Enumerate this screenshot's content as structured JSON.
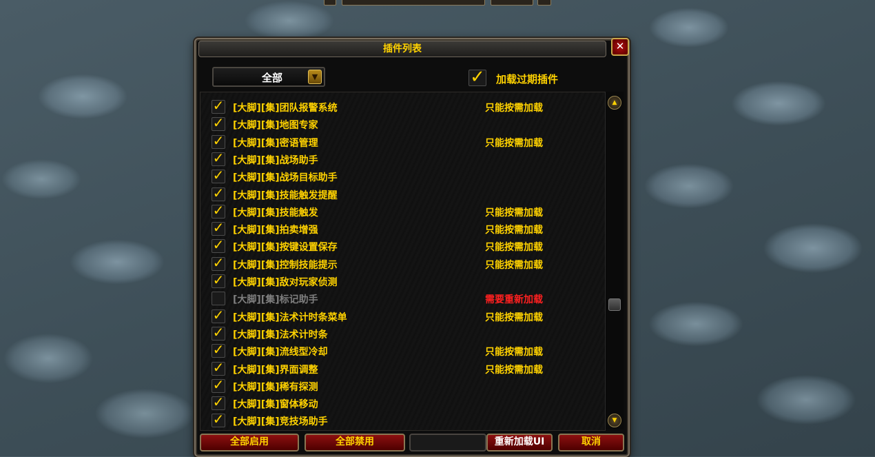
{
  "window": {
    "title": "插件列表",
    "close_glyph": "✕"
  },
  "filter": {
    "selected": "全部",
    "arrow_icon": "chevron-down-icon"
  },
  "load_expired": {
    "label": "加载过期插件",
    "checked": true
  },
  "addons": [
    {
      "name": "[大脚][集]团队报警系统",
      "enabled": true,
      "status": "只能按需加载"
    },
    {
      "name": "[大脚][集]地图专家",
      "enabled": true,
      "status": ""
    },
    {
      "name": "[大脚][集]密语管理",
      "enabled": true,
      "status": "只能按需加载"
    },
    {
      "name": "[大脚][集]战场助手",
      "enabled": true,
      "status": ""
    },
    {
      "name": "[大脚][集]战场目标助手",
      "enabled": true,
      "status": ""
    },
    {
      "name": "[大脚][集]技能触发提醒",
      "enabled": true,
      "status": ""
    },
    {
      "name": "[大脚][集]技能触发",
      "enabled": true,
      "status": "只能按需加载"
    },
    {
      "name": "[大脚][集]拍卖增强",
      "enabled": true,
      "status": "只能按需加载"
    },
    {
      "name": "[大脚][集]按键设置保存",
      "enabled": true,
      "status": "只能按需加载"
    },
    {
      "name": "[大脚][集]控制技能提示",
      "enabled": true,
      "status": "只能按需加载"
    },
    {
      "name": "[大脚][集]敌对玩家侦测",
      "enabled": true,
      "status": ""
    },
    {
      "name": "[大脚][集]标记助手",
      "enabled": false,
      "status": "需要重新加载"
    },
    {
      "name": "[大脚][集]法术计时条菜单",
      "enabled": true,
      "status": "只能按需加载"
    },
    {
      "name": "[大脚][集]法术计时条",
      "enabled": true,
      "status": ""
    },
    {
      "name": "[大脚][集]流线型冷却",
      "enabled": true,
      "status": "只能按需加载"
    },
    {
      "name": "[大脚][集]界面调整",
      "enabled": true,
      "status": "只能按需加载"
    },
    {
      "name": "[大脚][集]稀有探测",
      "enabled": true,
      "status": ""
    },
    {
      "name": "[大脚][集]窗体移动",
      "enabled": true,
      "status": ""
    },
    {
      "name": "[大脚][集]竞技场助手",
      "enabled": true,
      "status": ""
    }
  ],
  "colors": {
    "enabled_text": "#ffd200",
    "disabled_text": "#7f7f7f",
    "status_demand": "#ffd200",
    "status_reload": "#ff2020"
  },
  "buttons": {
    "enable_all": "全部启用",
    "disable_all": "全部禁用",
    "reload_ui": "重新加载UI",
    "cancel": "取消"
  },
  "scrollbar": {
    "up_icon": "▲",
    "down_icon": "▼"
  }
}
